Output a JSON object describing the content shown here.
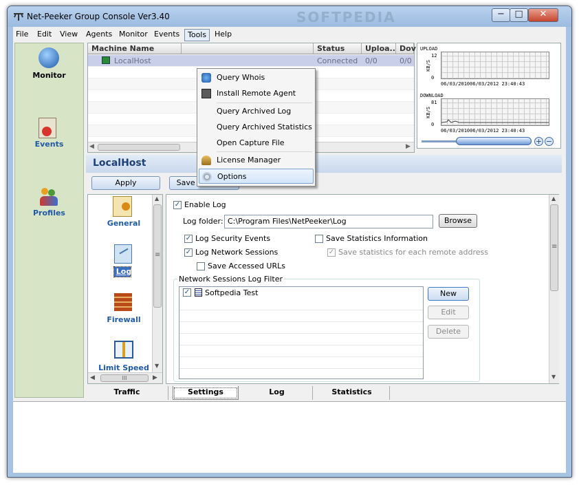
{
  "window": {
    "title": "Net-Peeker Group Console Ver3.40",
    "watermark": "SOFTPEDIA"
  },
  "menu": [
    "File",
    "Edit",
    "View",
    "Agents",
    "Monitor",
    "Events",
    "Tools",
    "Help"
  ],
  "sidebar": [
    {
      "label": "Monitor",
      "icon": "globe-icon"
    },
    {
      "label": "Events",
      "icon": "events-icon"
    },
    {
      "label": "Profiles",
      "icon": "users-icon"
    }
  ],
  "grid": {
    "columns": [
      "Machine Name",
      "Status",
      "Uploa...",
      "Dov"
    ],
    "rows": [
      {
        "name": "LocalHost",
        "status": "Connected",
        "upload": "0/0",
        "down": "0/0"
      }
    ]
  },
  "graphs": {
    "upload": {
      "label": "UPLOAD",
      "ymax": "12",
      "ymin": "0",
      "unit": "KB/S",
      "range": "06/03/201006/03/2012 23:40:43"
    },
    "download": {
      "label": "DOWNLOAD",
      "ymax": "81",
      "ymin": "0",
      "unit": "KB/S",
      "range": "06/03/201006/03/2012 23:40:43"
    }
  },
  "host": {
    "name": "LocalHost",
    "apply": "Apply",
    "save_profile": "Save as Profile"
  },
  "settings_nav": [
    "General",
    "Log",
    "Firewall",
    "Limit Speed"
  ],
  "log_settings": {
    "enable_log": "Enable Log",
    "log_folder_label": "Log folder:",
    "log_folder_value": "C:\\Program Files\\NetPeeker\\Log",
    "browse": "Browse",
    "log_security": "Log Security Events",
    "log_network": "Log Network Sessions",
    "save_urls": "Save Accessed URLs",
    "save_stats": "Save Statistics Information",
    "save_stats_remote": "Save statistics for each remote address",
    "filter_group": "Network Sessions Log Filter",
    "filter_items": [
      "Softpedia Test"
    ],
    "btn_new": "New",
    "btn_edit": "Edit",
    "btn_delete": "Delete"
  },
  "tabs": [
    "Traffic",
    "Settings",
    "Log",
    "Statistics"
  ],
  "tools_menu": [
    "Query Whois",
    "Install Remote Agent",
    "Query Archived Log",
    "Query Archived Statistics",
    "Open Capture File",
    "License Manager",
    "Options"
  ],
  "win_controls": {
    "minimize": "−",
    "maximize": "□",
    "close": "✕"
  },
  "scroll_glyphs": {
    "up": "▲",
    "down": "▼",
    "left": "◀",
    "right": "▶",
    "grip": "≡",
    "hgrip": "III"
  },
  "check_glyph": "✓",
  "zoom": {
    "in": "+",
    "out": "−"
  }
}
